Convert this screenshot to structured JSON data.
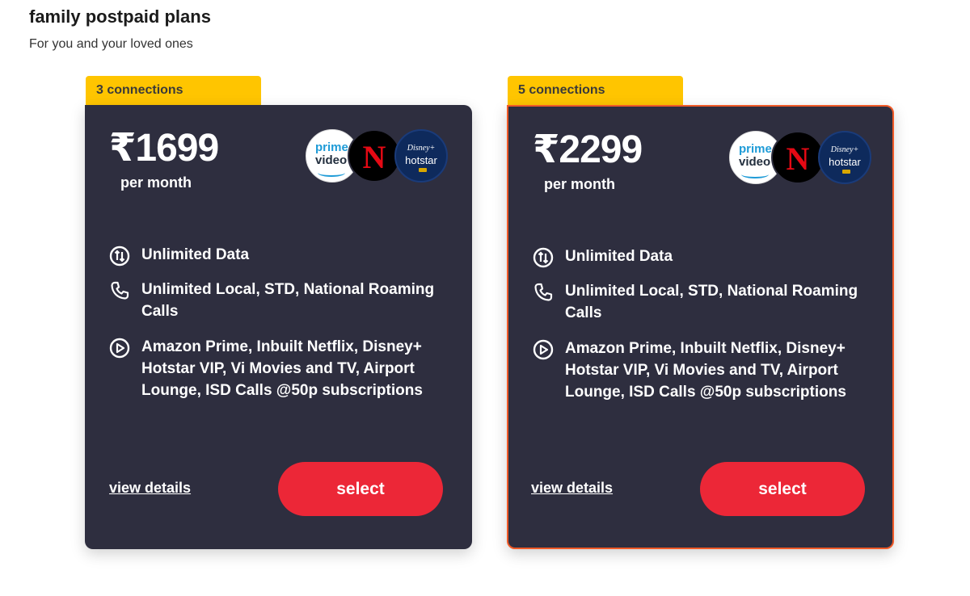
{
  "header": {
    "title": "family postpaid plans",
    "subtitle": "For you and your loved ones"
  },
  "plans": [
    {
      "tag": "3 connections",
      "price": "₹1699",
      "period": "per month",
      "ott_logos": [
        "prime-video-logo",
        "netflix-logo",
        "disney-hotstar-logo"
      ],
      "features": [
        {
          "icon": "data-arrows-icon",
          "text": "Unlimited Data"
        },
        {
          "icon": "phone-icon",
          "text": "Unlimited Local, STD, National Roaming Calls"
        },
        {
          "icon": "play-icon",
          "text": "Amazon Prime, Inbuilt Netflix, Disney+ Hotstar VIP, Vi Movies and TV, Airport Lounge, ISD Calls @50p subscriptions"
        }
      ],
      "view_details_label": "view details",
      "select_label": "select",
      "highlighted": false
    },
    {
      "tag": "5 connections",
      "price": "₹2299",
      "period": "per month",
      "ott_logos": [
        "prime-video-logo",
        "netflix-logo",
        "disney-hotstar-logo"
      ],
      "features": [
        {
          "icon": "data-arrows-icon",
          "text": "Unlimited Data"
        },
        {
          "icon": "phone-icon",
          "text": "Unlimited Local, STD, National Roaming Calls"
        },
        {
          "icon": "play-icon",
          "text": "Amazon Prime, Inbuilt Netflix, Disney+ Hotstar VIP, Vi Movies and TV, Airport Lounge, ISD Calls @50p subscriptions"
        }
      ],
      "view_details_label": "view details",
      "select_label": "select",
      "highlighted": true
    }
  ],
  "logos": {
    "prime_line1": "prime",
    "prime_line2": "video",
    "netflix": "N",
    "hotstar_top": "Disney+",
    "hotstar_name": "hotstar"
  },
  "colors": {
    "tag": "#ffc500",
    "card": "#2e2e3f",
    "select": "#ec2737",
    "highlight_border": "#f05a28"
  }
}
